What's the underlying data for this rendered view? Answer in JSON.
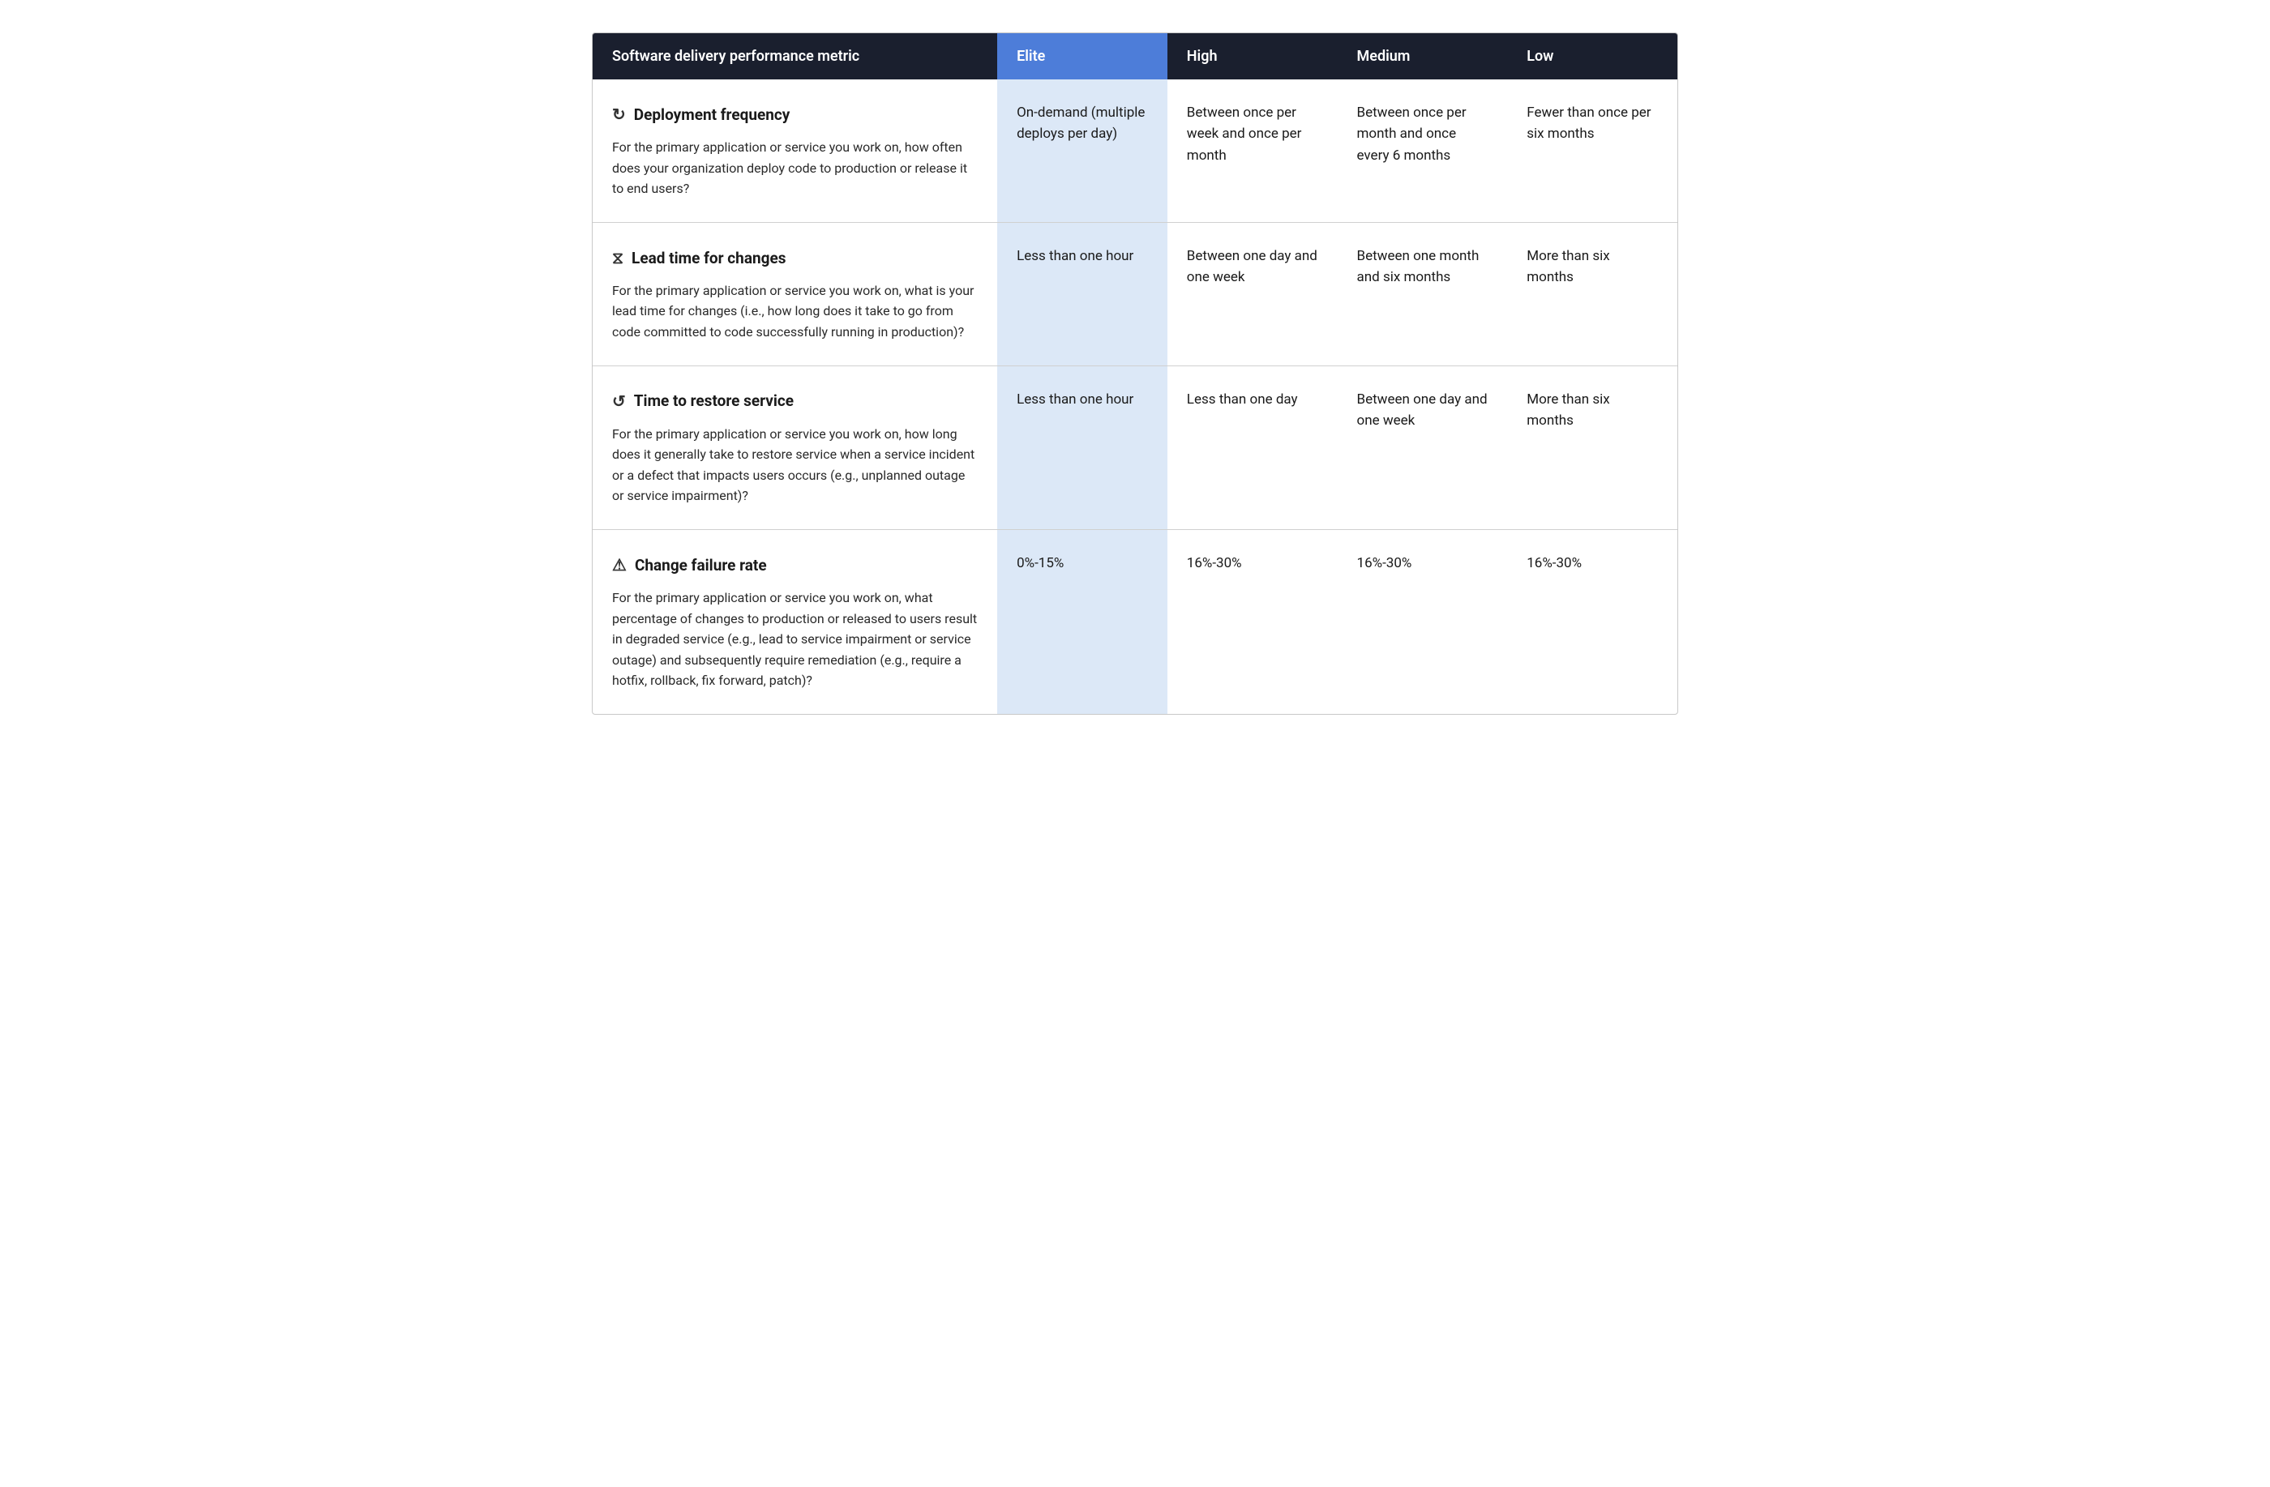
{
  "header": {
    "metric_col": "Software delivery performance metric",
    "elite_col": "Elite",
    "high_col": "High",
    "medium_col": "Medium",
    "low_col": "Low"
  },
  "rows": [
    {
      "id": "deployment-frequency",
      "icon": "↻",
      "title": "Deployment frequency",
      "description": "For the primary application or service you work on, how often does your organization deploy code to production or release it to end users?",
      "elite": "On-demand (multiple deploys per day)",
      "high": "Between once per week and once per month",
      "medium": "Between once per month and once every 6 months",
      "low": "Fewer than once per six months"
    },
    {
      "id": "lead-time",
      "icon": "⧖",
      "title": "Lead time for changes",
      "description": "For the primary application or service you work on, what is your lead time for changes (i.e., how long does it take to go from code committed to code successfully running in production)?",
      "elite": "Less than one hour",
      "high": "Between one day and one week",
      "medium": "Between one month and six months",
      "low": "More than six months"
    },
    {
      "id": "restore-service",
      "icon": "↺",
      "title": "Time to restore service",
      "description": "For the primary application or service you work on, how long does it generally take to restore service when a service incident or a defect that impacts users occurs (e.g., unplanned outage or service impairment)?",
      "elite": "Less than one hour",
      "high": "Less than one day",
      "medium": "Between one day and one week",
      "low": "More than six months"
    },
    {
      "id": "change-failure-rate",
      "icon": "⚠",
      "title": "Change failure rate",
      "description": "For the primary application or service you work on, what percentage of changes to production or released to users result in degraded service (e.g., lead to service impairment or service outage) and subsequently require remediation (e.g., require a hotfix, rollback, fix forward, patch)?",
      "elite": "0%-15%",
      "high": "16%-30%",
      "medium": "16%-30%",
      "low": "16%-30%"
    }
  ]
}
